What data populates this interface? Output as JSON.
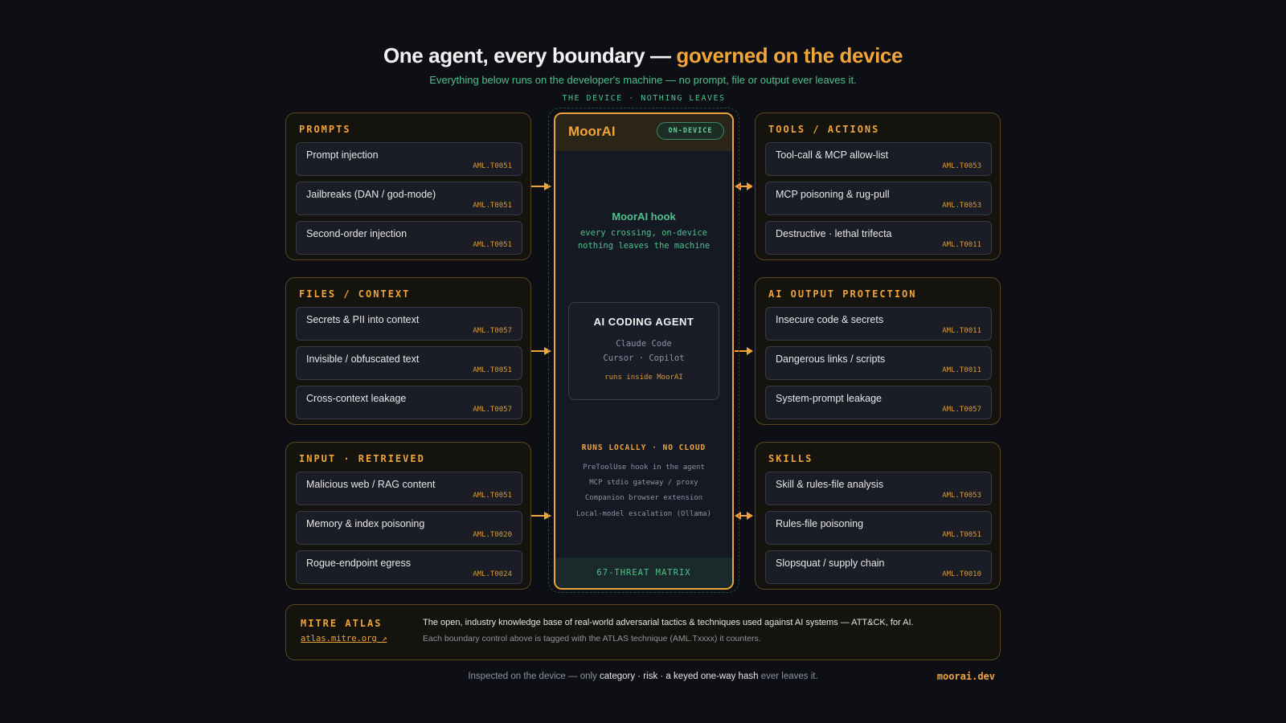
{
  "header": {
    "title_main": "One agent, every boundary — ",
    "title_highlight": "governed on the device",
    "subtitle": "Everything below runs on the developer's machine — no prompt, file or output ever leaves it."
  },
  "device": {
    "zone_label": "THE DEVICE · NOTHING LEAVES",
    "brand": "MoorAI",
    "badge": "ON-DEVICE",
    "hook_title": "MoorAI hook",
    "hook_lines": [
      "every crossing, on-device",
      "nothing leaves the machine"
    ],
    "agent": {
      "title": "AI CODING AGENT",
      "lines": [
        "Claude Code",
        "Cursor · Copilot"
      ],
      "note": "runs inside MoorAI"
    },
    "local_title": "RUNS LOCALLY · NO CLOUD",
    "local_lines": [
      "PreToolUse hook in the agent",
      "MCP stdio gateway / proxy",
      "Companion browser extension",
      "Local-model escalation (Ollama)"
    ],
    "matrix": "67-THREAT MATRIX"
  },
  "panels": {
    "prompts": {
      "title": "PROMPTS",
      "items": [
        {
          "label": "Prompt injection",
          "code": "AML.T0051"
        },
        {
          "label": "Jailbreaks (DAN / god-mode)",
          "code": "AML.T0051"
        },
        {
          "label": "Second-order injection",
          "code": "AML.T0051"
        }
      ]
    },
    "files": {
      "title": "FILES / CONTEXT",
      "items": [
        {
          "label": "Secrets & PII into context",
          "code": "AML.T0057"
        },
        {
          "label": "Invisible / obfuscated text",
          "code": "AML.T0051"
        },
        {
          "label": "Cross-context leakage",
          "code": "AML.T0057"
        }
      ]
    },
    "input": {
      "title": "INPUT · RETRIEVED",
      "items": [
        {
          "label": "Malicious web / RAG content",
          "code": "AML.T0051"
        },
        {
          "label": "Memory & index poisoning",
          "code": "AML.T0020"
        },
        {
          "label": "Rogue-endpoint egress",
          "code": "AML.T0024"
        }
      ]
    },
    "tools": {
      "title": "TOOLS / ACTIONS",
      "items": [
        {
          "label": "Tool-call & MCP allow-list",
          "code": "AML.T0053"
        },
        {
          "label": "MCP poisoning & rug-pull",
          "code": "AML.T0053"
        },
        {
          "label": "Destructive · lethal trifecta",
          "code": "AML.T0011"
        }
      ]
    },
    "output": {
      "title": "AI OUTPUT PROTECTION",
      "items": [
        {
          "label": "Insecure code & secrets",
          "code": "AML.T0011"
        },
        {
          "label": "Dangerous links / scripts",
          "code": "AML.T0011"
        },
        {
          "label": "System-prompt leakage",
          "code": "AML.T0057"
        }
      ]
    },
    "skills": {
      "title": "SKILLS",
      "items": [
        {
          "label": "Skill & rules-file analysis",
          "code": "AML.T0053"
        },
        {
          "label": "Rules-file poisoning",
          "code": "AML.T0051"
        },
        {
          "label": "Slopsquat / supply chain",
          "code": "AML.T0010"
        }
      ]
    }
  },
  "atlas": {
    "title": "MITRE ATLAS",
    "link": "atlas.mitre.org ↗",
    "description": "The open, industry knowledge base of real-world adversarial tactics & techniques used against AI systems — ATT&CK, for AI.",
    "note": "Each boundary control above is tagged with the ATLAS technique (AML.Txxxx) it counters."
  },
  "footer": {
    "prefix": "Inspected on the device — only ",
    "emphasis": "category · risk · a keyed one-way hash",
    "suffix": " ever leaves it.",
    "site": "moorai.dev"
  },
  "colors": {
    "accent": "#f0a43a",
    "green": "#4fc08d",
    "background": "#0d0f15"
  }
}
